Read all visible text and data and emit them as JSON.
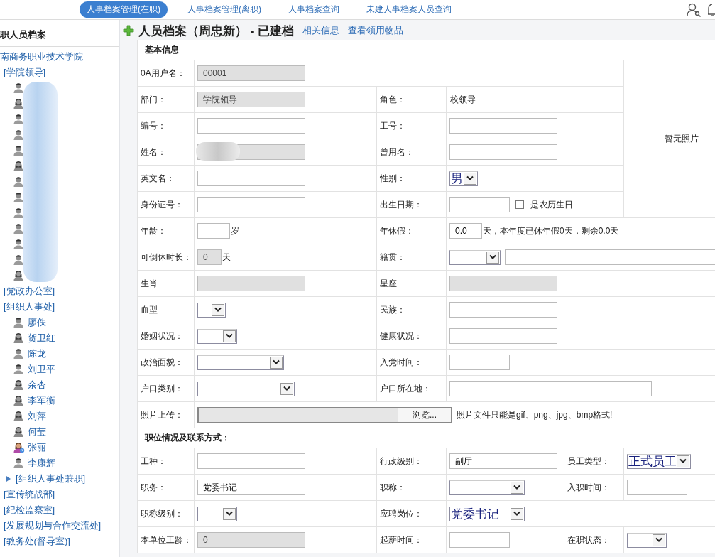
{
  "nav": {
    "tabs": [
      {
        "label": "人事档案管理(在职)",
        "selected": true
      },
      {
        "label": "人事档案管理(离职)",
        "selected": false
      },
      {
        "label": "人事档案查询",
        "selected": false
      },
      {
        "label": "未建人事档案人员查询",
        "selected": false
      }
    ]
  },
  "sidebar": {
    "title": "职人员档案",
    "root": "南商务职业技术学院",
    "groups": [
      {
        "label": "[学院领导]",
        "redacted": true,
        "children": [
          {
            "kind": "male"
          },
          {
            "kind": "female"
          },
          {
            "kind": "male"
          },
          {
            "kind": "male"
          },
          {
            "kind": "male"
          },
          {
            "kind": "female"
          },
          {
            "kind": "male"
          },
          {
            "kind": "male"
          },
          {
            "kind": "male"
          },
          {
            "kind": "male"
          },
          {
            "kind": "male"
          },
          {
            "kind": "male"
          },
          {
            "kind": "female"
          }
        ]
      },
      {
        "label": "[党政办公室]"
      },
      {
        "label": "[组织人事处]",
        "children": [
          {
            "kind": "male",
            "name": "廖佚"
          },
          {
            "kind": "female",
            "name": "贺卫红"
          },
          {
            "kind": "male",
            "name": "陈龙"
          },
          {
            "kind": "male",
            "name": "刘卫平"
          },
          {
            "kind": "female",
            "name": "余杏"
          },
          {
            "kind": "female",
            "name": "李军衡"
          },
          {
            "kind": "female",
            "name": "刘萍"
          },
          {
            "kind": "female",
            "name": "何莹"
          },
          {
            "kind": "female-busy",
            "name": "张丽"
          },
          {
            "kind": "male",
            "name": "李康辉"
          }
        ]
      },
      {
        "label": "[组织人事处兼职]",
        "expanded": false
      },
      {
        "label": "[宣传统战部]"
      },
      {
        "label": "[纪检监察室]"
      },
      {
        "label": "[发展规划与合作交流处]"
      },
      {
        "label": "[教务处(督导室)]"
      }
    ]
  },
  "page": {
    "title": "人员档案（周忠新） - 已建档",
    "links": [
      "相关信息",
      "查看领用物品"
    ]
  },
  "form": {
    "sections": [
      {
        "title": "基本信息",
        "photo_placeholder": "暂无照片",
        "rows": [
          [
            {
              "label": "0A用户名：",
              "controls": [
                {
                  "kind": "readonly",
                  "value": "00001"
                }
              ]
            }
          ],
          [
            {
              "label": "部门：",
              "controls": [
                {
                  "kind": "readonly",
                  "value": "学院领导"
                }
              ]
            },
            {
              "label": "角色：",
              "controls": [
                {
                  "kind": "static",
                  "text": "校领导"
                }
              ]
            }
          ],
          [
            {
              "label": "编号：",
              "controls": [
                {
                  "kind": "text"
                }
              ]
            },
            {
              "label": "工号：",
              "controls": [
                {
                  "kind": "text"
                }
              ]
            }
          ],
          [
            {
              "label": "姓名：",
              "controls": [
                {
                  "kind": "readonly",
                  "redacted": true
                }
              ]
            },
            {
              "label": "曾用名：",
              "controls": [
                {
                  "kind": "text"
                }
              ]
            }
          ],
          [
            {
              "label": "英文名：",
              "controls": [
                {
                  "kind": "text"
                }
              ]
            },
            {
              "label": "性别：",
              "controls": [
                {
                  "kind": "select",
                  "value": "男"
                }
              ]
            }
          ],
          [
            {
              "label": "身份证号：",
              "controls": [
                {
                  "kind": "text"
                }
              ]
            },
            {
              "label": "出生日期：",
              "controls": [
                {
                  "kind": "text"
                },
                {
                  "kind": "checkbox",
                  "text": "是农历生日",
                  "checked": false
                }
              ]
            }
          ],
          [
            {
              "label": "年龄：",
              "controls": [
                {
                  "kind": "text"
                },
                {
                  "kind": "static",
                  "text": "岁"
                }
              ]
            },
            {
              "label": "年休假：",
              "controls": [
                {
                  "kind": "text",
                  "value": "0.0"
                },
                {
                  "kind": "static",
                  "text": "天，本年度已休年假0天，剩余0.0天"
                }
              ]
            }
          ],
          [
            {
              "label": "可倒休时长：",
              "controls": [
                {
                  "kind": "readonly",
                  "value": "0"
                },
                {
                  "kind": "static",
                  "text": "天"
                }
              ]
            },
            {
              "label": "籍贯：",
              "controls": [
                {
                  "kind": "select"
                },
                {
                  "kind": "text"
                }
              ]
            }
          ],
          [
            {
              "label": "生肖",
              "controls": [
                {
                  "kind": "readonly"
                }
              ]
            },
            {
              "label": "星座",
              "controls": [
                {
                  "kind": "readonly"
                }
              ]
            }
          ],
          [
            {
              "label": "血型",
              "controls": [
                {
                  "kind": "select"
                }
              ]
            },
            {
              "label": "民族：",
              "controls": [
                {
                  "kind": "text"
                }
              ]
            }
          ],
          [
            {
              "label": "婚姻状况：",
              "controls": [
                {
                  "kind": "select"
                }
              ]
            },
            {
              "label": "健康状况：",
              "controls": [
                {
                  "kind": "text"
                }
              ]
            }
          ],
          [
            {
              "label": "政治面貌：",
              "controls": [
                {
                  "kind": "select"
                }
              ]
            },
            {
              "label": "入党时间：",
              "controls": [
                {
                  "kind": "text"
                }
              ]
            }
          ],
          [
            {
              "label": "户口类别：",
              "controls": [
                {
                  "kind": "select"
                }
              ]
            },
            {
              "label": "户口所在地：",
              "controls": [
                {
                  "kind": "text"
                }
              ]
            }
          ],
          [
            {
              "label": "照片上传：",
              "controls": [
                {
                  "kind": "file",
                  "button": "浏览..."
                },
                {
                  "kind": "static",
                  "text": "照片文件只能是gif、png、jpg、bmp格式!"
                }
              ]
            }
          ]
        ]
      },
      {
        "title": "职位情况及联系方式：",
        "rows": [
          [
            {
              "label": "工种：",
              "controls": [
                {
                  "kind": "text"
                }
              ]
            },
            {
              "label": "行政级别：",
              "controls": [
                {
                  "kind": "text",
                  "value": "副厅"
                }
              ]
            },
            {
              "label": "员工类型：",
              "controls": [
                {
                  "kind": "select",
                  "value": "正式员工"
                }
              ]
            }
          ],
          [
            {
              "label": "职务：",
              "controls": [
                {
                  "kind": "text",
                  "value": "党委书记"
                }
              ]
            },
            {
              "label": "职称：",
              "controls": [
                {
                  "kind": "select"
                }
              ]
            },
            {
              "label": "入职时间：",
              "controls": [
                {
                  "kind": "text"
                }
              ]
            }
          ],
          [
            {
              "label": "职称级别：",
              "controls": [
                {
                  "kind": "select"
                }
              ]
            },
            {
              "label": "应聘岗位：",
              "controls": [
                {
                  "kind": "select",
                  "value": "党委书记"
                }
              ]
            }
          ],
          [
            {
              "label": "本单位工龄：",
              "controls": [
                {
                  "kind": "readonly",
                  "value": "0"
                }
              ]
            },
            {
              "label": "起薪时间：",
              "controls": [
                {
                  "kind": "text"
                }
              ]
            },
            {
              "label": "在职状态：",
              "controls": [
                {
                  "kind": "select"
                }
              ]
            }
          ]
        ]
      }
    ]
  }
}
